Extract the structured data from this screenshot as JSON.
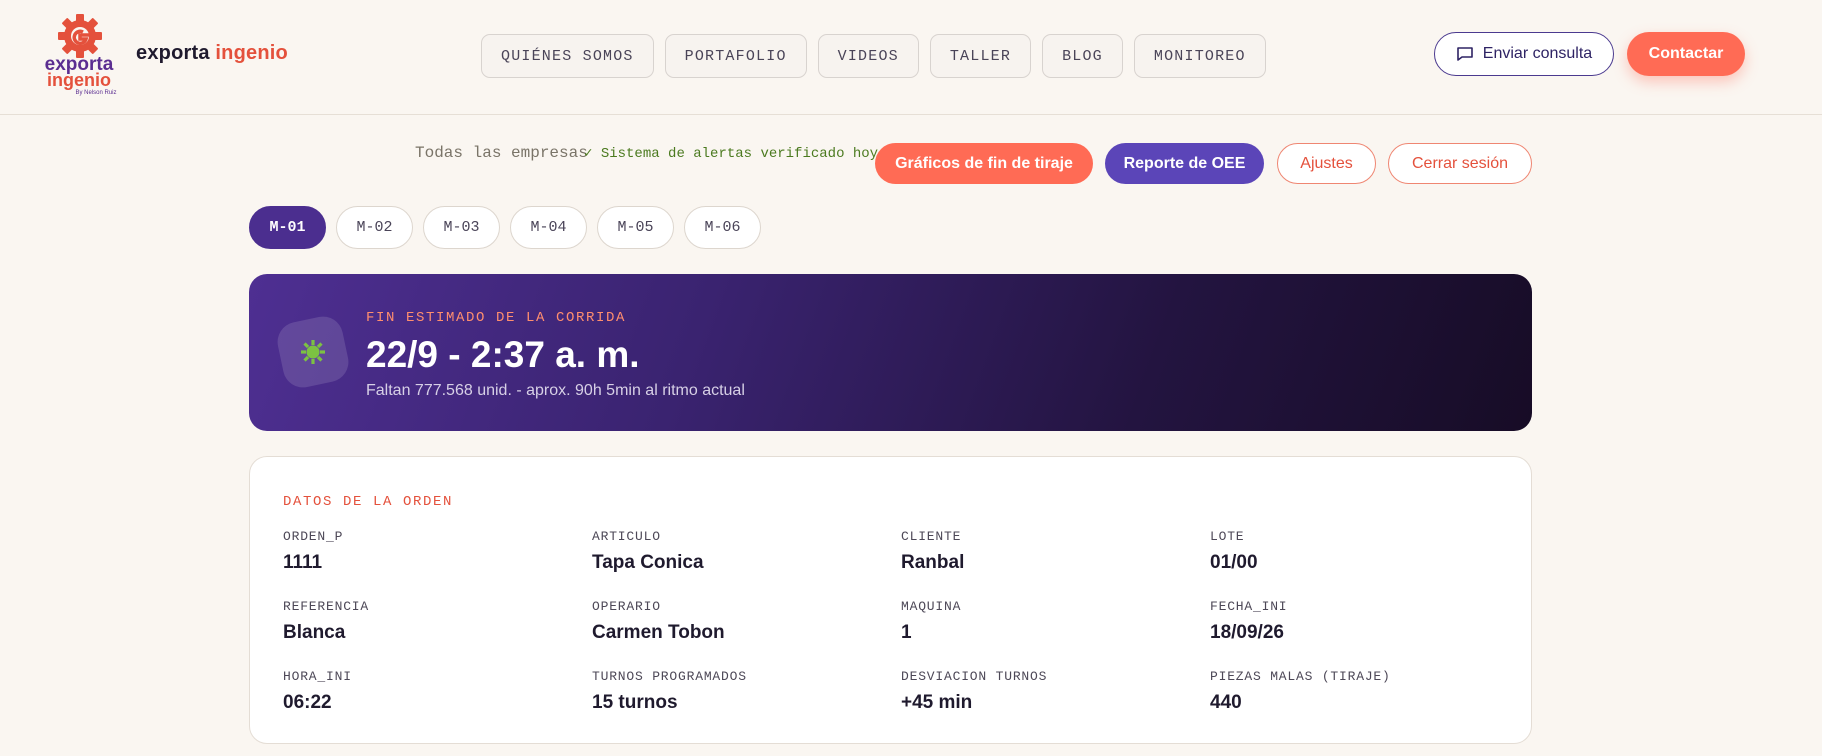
{
  "brand": {
    "logo_text_1": "exporta",
    "logo_text_2": "ingenio",
    "logo_sub": "By Nelson Ruiz",
    "name_1": "exporta",
    "name_2": "ingenio",
    "accent": "#e4513c",
    "primary": "#4b2e8f"
  },
  "nav": {
    "items": [
      "QUIÉNES SOMOS",
      "PORTAFOLIO",
      "VIDEOS",
      "TALLER",
      "BLOG",
      "MONITOREO"
    ]
  },
  "header_actions": {
    "consulta_label": "Enviar consulta",
    "consulta_icon": "chat-bubble-icon",
    "contactar_label": "Contactar"
  },
  "toolbar": {
    "filter": "Todas las empresas",
    "alert_status": "✓ Sistema de alertas verificado hoy",
    "graficos_label": "Gráficos de fin de tiraje",
    "oee_label": "Reporte de OEE",
    "ajustes_label": "Ajustes",
    "cerrar_label": "Cerrar sesión"
  },
  "machines": {
    "tabs": [
      "M-01",
      "M-02",
      "M-03",
      "M-04",
      "M-05",
      "M-06"
    ],
    "active": "M-01"
  },
  "estimate": {
    "label": "FIN ESTIMADO DE LA CORRIDA",
    "time": "22/9 - 2:37 a. m.",
    "remaining": "Faltan 777.568 unid. - aprox. 90h 5min al ritmo actual",
    "icon": "gear-icon",
    "icon_color": "#7cc242"
  },
  "order": {
    "title": "DATOS DE LA ORDEN",
    "fields": [
      {
        "label": "ORDEN_P",
        "value": "1111"
      },
      {
        "label": "ARTICULO",
        "value": "Tapa Conica"
      },
      {
        "label": "CLIENTE",
        "value": "Ranbal"
      },
      {
        "label": "LOTE",
        "value": "01/00"
      },
      {
        "label": "REFERENCIA",
        "value": "Blanca"
      },
      {
        "label": "OPERARIO",
        "value": "Carmen Tobon"
      },
      {
        "label": "MAQUINA",
        "value": "1"
      },
      {
        "label": "FECHA_INI",
        "value": "18/09/26"
      },
      {
        "label": "HORA_INI",
        "value": "06:22"
      },
      {
        "label": "TURNOS PROGRAMADOS",
        "value": "15 turnos"
      },
      {
        "label": "DESVIACION TURNOS",
        "value": "+45 min"
      },
      {
        "label": "PIEZAS MALAS (TIRAJE)",
        "value": "440"
      }
    ]
  }
}
